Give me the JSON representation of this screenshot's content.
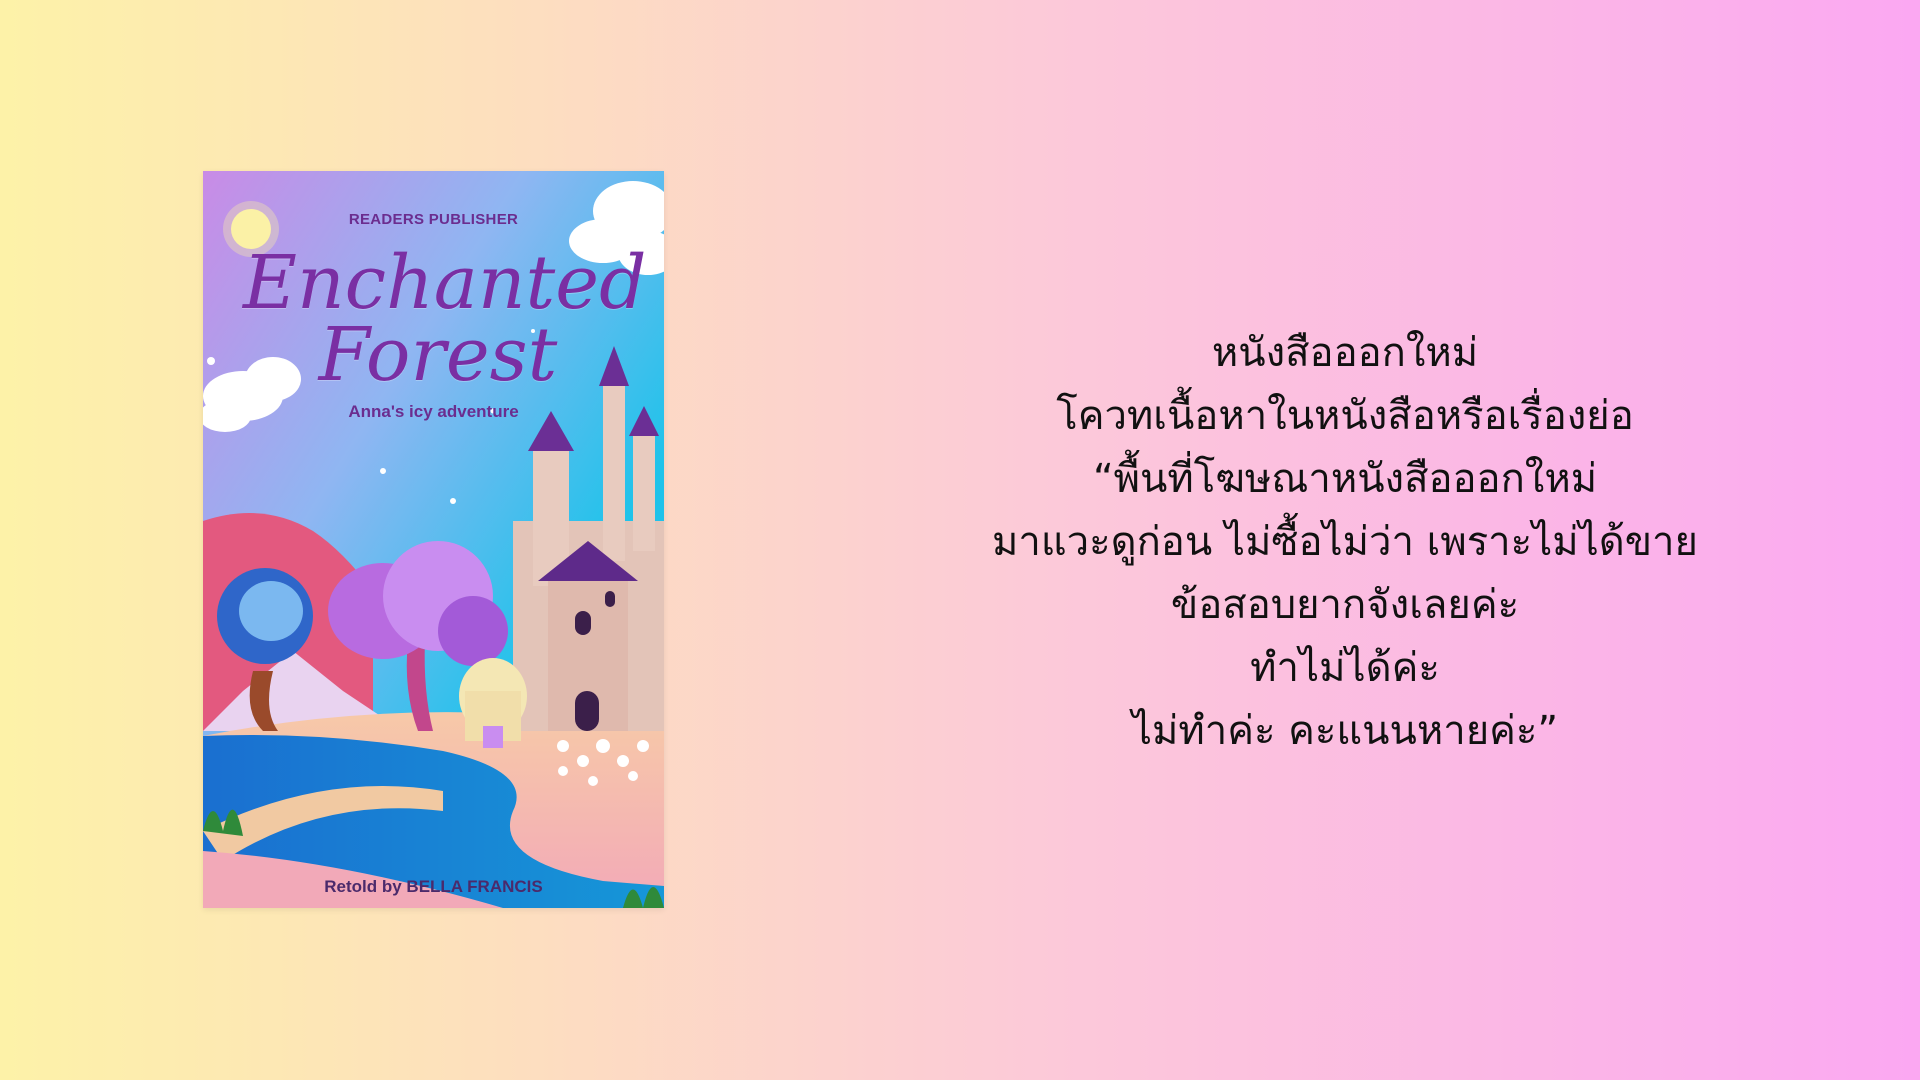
{
  "book": {
    "publisher": "READERS PUBLISHER",
    "title_line1": "Enchanted",
    "title_line2": "Forest",
    "subtitle": "Anna's icy adventure",
    "author": "Retold by BELLA FRANCIS"
  },
  "quote": {
    "lines": [
      "หนังสือออกใหม่",
      "โควทเนื้อหาในหนังสือหรือเรื่องย่อ",
      "“พื้นที่โฆษณาหนังสือออกใหม่",
      "มาแวะดูก่อน ไม่ซื้อไม่ว่า เพราะไม่ได้ขาย",
      "ข้อสอบยากจังเลยค่ะ",
      "ทำไม่ได้ค่ะ",
      "ไม่ทำค่ะ คะแนนหายค่ะ”"
    ]
  },
  "colors": {
    "title": "#7a2fa3",
    "quote_text": "#111111"
  }
}
